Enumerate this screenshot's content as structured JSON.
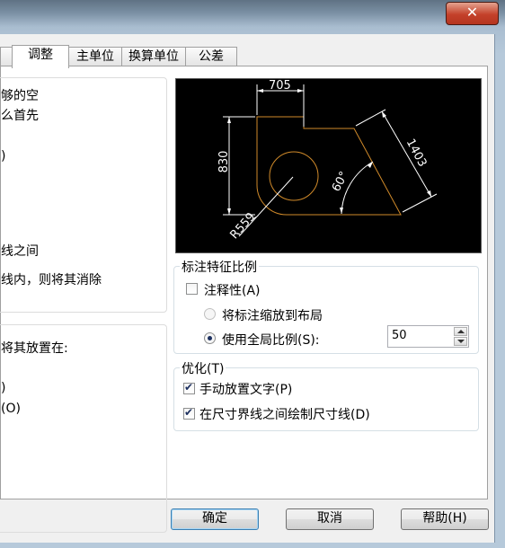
{
  "window": {
    "close_glyph": "✕"
  },
  "tabs": [
    {
      "label": ""
    },
    {
      "label": "调整"
    },
    {
      "label": "主单位"
    },
    {
      "label": "换算单位"
    },
    {
      "label": "公差"
    }
  ],
  "left_panel": {
    "lines_top": [
      "够的空",
      "么首先",
      ")",
      "线之间",
      "线内，则将其消除"
    ],
    "lines_bottom": [
      "将其放置在:",
      ")",
      "(O)"
    ]
  },
  "preview": {
    "dim_top": "705",
    "dim_left": "830",
    "dim_right": "1403",
    "dim_angle": "60°",
    "dim_radius": "R559"
  },
  "scale_group": {
    "title": "标注特征比例",
    "annotative_label": "注释性(A)",
    "annotative_checked": false,
    "layout_label": "将标注缩放到布局",
    "global_label": "使用全局比例(S):",
    "global_value": "50"
  },
  "optimize_group": {
    "title": "优化(T)",
    "manual_label": "手动放置文字(P)",
    "manual_checked": true,
    "draw_line_label": "在尺寸界线之间绘制尺寸线(D)",
    "draw_line_checked": true
  },
  "buttons": {
    "ok": "确定",
    "cancel": "取消",
    "help": "帮助(H)"
  },
  "colors": {
    "preview_bg": "#000000",
    "geometry": "#d08a2a",
    "dimension": "#ffffff"
  }
}
